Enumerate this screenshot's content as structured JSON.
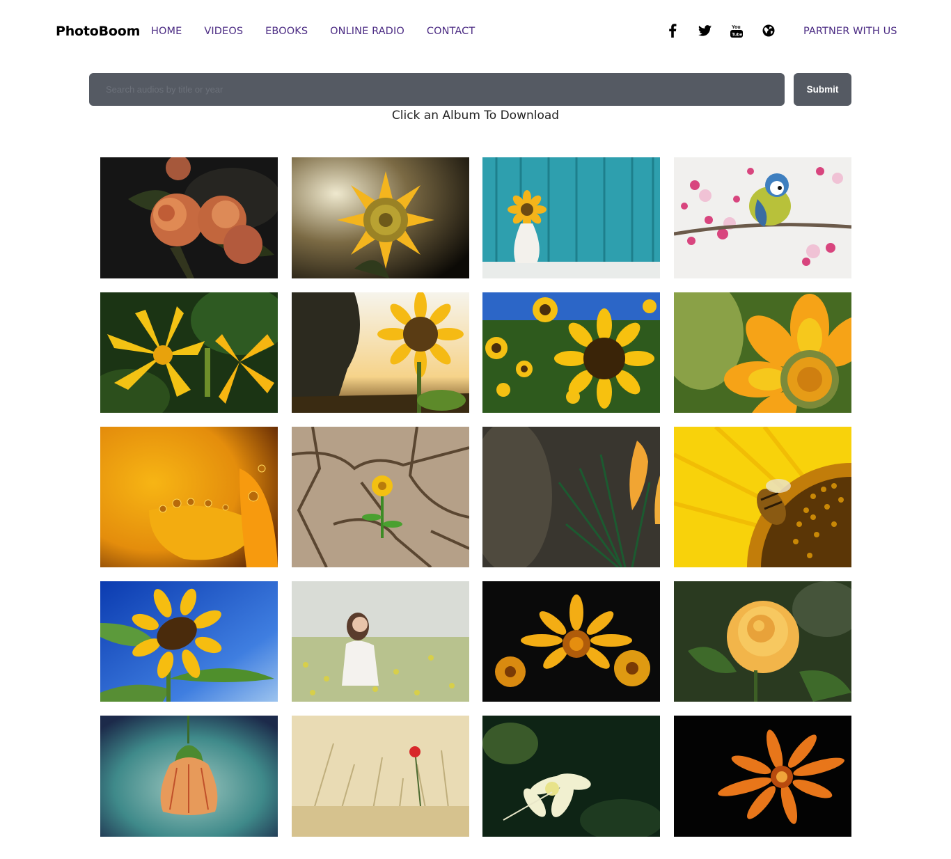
{
  "brand": "PhotoBoom",
  "nav": {
    "items": [
      "HOME",
      "VIDEOS",
      "EBOOKS",
      "ONLINE RADIO",
      "CONTACT"
    ],
    "partner": "PARTNER WITH US"
  },
  "social_icons": [
    "facebook-icon",
    "twitter-icon",
    "youtube-icon",
    "globe-icon"
  ],
  "search": {
    "placeholder": "Search audios by title or year",
    "value": "",
    "submit_label": "Submit"
  },
  "subtitle": "Click an Album To Download",
  "gallery": {
    "albums": [
      "roses-dark",
      "sunflower-closeup",
      "sunflower-vase",
      "blue-tit-bird",
      "yellow-lilies",
      "sunflower-sunset",
      "sunflower-field",
      "orange-gazania",
      "petal-dewdrops",
      "flower-cracked-earth",
      "crocus-buds",
      "bee-on-sunflower",
      "sunflower-blue-sky",
      "woman-in-field",
      "gazania-dark",
      "yellow-rose",
      "hanging-bell-flower",
      "poppy-in-grass",
      "white-columbine",
      "orange-daisy-dark"
    ]
  },
  "colors": {
    "nav_link": "#4b2b83",
    "search_bg": "#555a63",
    "brand": "#000000"
  }
}
